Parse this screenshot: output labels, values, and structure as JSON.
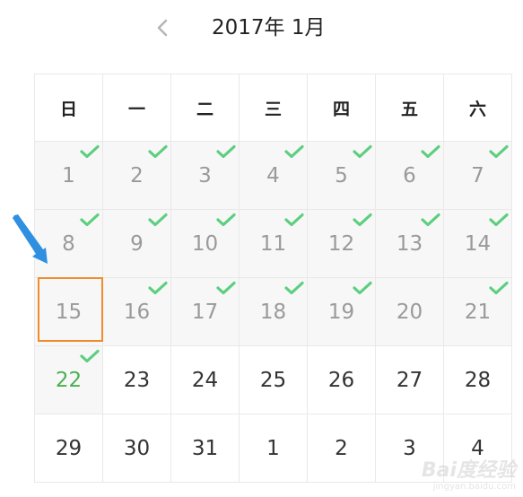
{
  "header": {
    "title": "2017年 1月",
    "prev_icon": "chevron-left-icon"
  },
  "weekdays": [
    "日",
    "一",
    "二",
    "三",
    "四",
    "五",
    "六"
  ],
  "days": [
    {
      "label": "1",
      "state": "past",
      "checked": true
    },
    {
      "label": "2",
      "state": "past",
      "checked": true
    },
    {
      "label": "3",
      "state": "past",
      "checked": true
    },
    {
      "label": "4",
      "state": "past",
      "checked": true
    },
    {
      "label": "5",
      "state": "past",
      "checked": true
    },
    {
      "label": "6",
      "state": "past",
      "checked": true
    },
    {
      "label": "7",
      "state": "past",
      "checked": true
    },
    {
      "label": "8",
      "state": "past",
      "checked": true
    },
    {
      "label": "9",
      "state": "past",
      "checked": true
    },
    {
      "label": "10",
      "state": "past",
      "checked": true
    },
    {
      "label": "11",
      "state": "past",
      "checked": true
    },
    {
      "label": "12",
      "state": "past",
      "checked": true
    },
    {
      "label": "13",
      "state": "past",
      "checked": true
    },
    {
      "label": "14",
      "state": "past",
      "checked": true
    },
    {
      "label": "15",
      "state": "past",
      "checked": false,
      "selected": true
    },
    {
      "label": "16",
      "state": "past",
      "checked": true
    },
    {
      "label": "17",
      "state": "past",
      "checked": true
    },
    {
      "label": "18",
      "state": "past",
      "checked": true
    },
    {
      "label": "19",
      "state": "past",
      "checked": true
    },
    {
      "label": "20",
      "state": "past",
      "checked": false
    },
    {
      "label": "21",
      "state": "past",
      "checked": true
    },
    {
      "label": "22",
      "state": "today",
      "checked": true
    },
    {
      "label": "23",
      "state": "future",
      "checked": false
    },
    {
      "label": "24",
      "state": "future",
      "checked": false
    },
    {
      "label": "25",
      "state": "future",
      "checked": false
    },
    {
      "label": "26",
      "state": "future",
      "checked": false
    },
    {
      "label": "27",
      "state": "future",
      "checked": false
    },
    {
      "label": "28",
      "state": "future",
      "checked": false
    },
    {
      "label": "29",
      "state": "future",
      "checked": false
    },
    {
      "label": "30",
      "state": "future",
      "checked": false
    },
    {
      "label": "31",
      "state": "future",
      "checked": false
    },
    {
      "label": "1",
      "state": "next",
      "checked": false
    },
    {
      "label": "2",
      "state": "next",
      "checked": false
    },
    {
      "label": "3",
      "state": "next",
      "checked": false
    },
    {
      "label": "4",
      "state": "next",
      "checked": false
    }
  ],
  "colors": {
    "check": "#5ccf7f",
    "today_text": "#4caf50",
    "past_text": "#9a9a9a",
    "selection_border": "#f08c2e",
    "annotation_arrow": "#2f8fe0"
  },
  "watermark": {
    "logo": "Bai度经验",
    "sub": "jingyan.baidu.com"
  }
}
